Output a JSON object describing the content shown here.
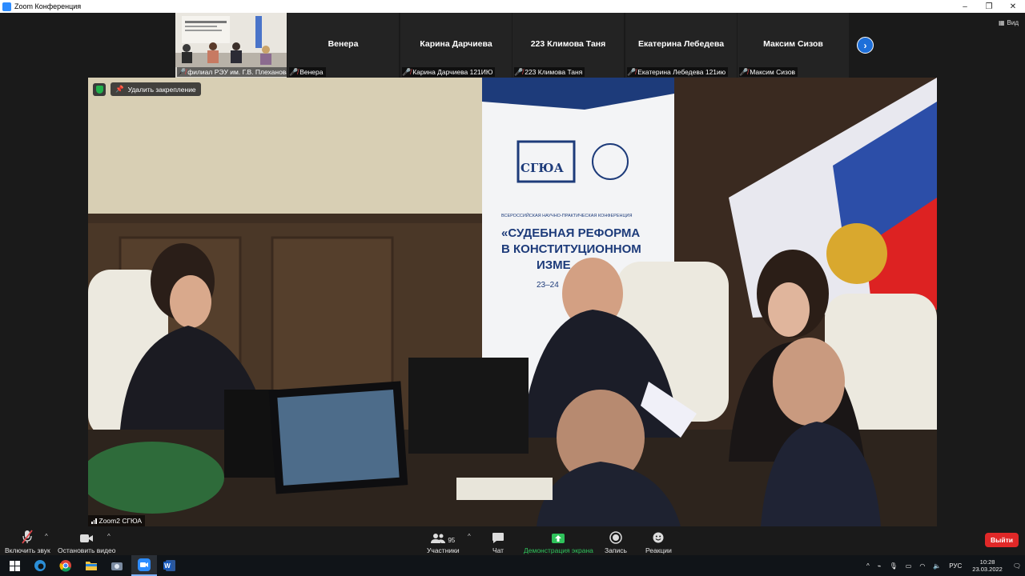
{
  "window": {
    "title": "Zoom Конференция",
    "controls": [
      "–",
      "❐",
      "✕"
    ]
  },
  "gallery": {
    "view_label": "Вид",
    "video_tile": {
      "label": "филиал РЭУ им. Г.В. Плеханова"
    },
    "tiles": [
      {
        "name": "Венера",
        "label": "Венера"
      },
      {
        "name": "Карина  Дарчиева",
        "label": "Карина Дарчиева 121ИЮ"
      },
      {
        "name": "223 Климова Таня",
        "label": "223 Климова Таня"
      },
      {
        "name": "Екатерина  Лебедева",
        "label": "Екатерина Лебедева 121ию"
      },
      {
        "name": "Максим Сизов",
        "label": "Максим Сизов"
      }
    ]
  },
  "main": {
    "unpin_label": "Удалить закрепление",
    "speaker_label": "Zoom2 СГЮА",
    "banner": {
      "org": "СГЮА",
      "subtitle": "ВСЕРОССИЙСКАЯ НАУЧНО-ПРАКТИЧЕСКАЯ КОНФЕРЕНЦИЯ",
      "line1": "«СУДЕБНАЯ РЕФОРМА",
      "line2": "В КОНСТИТУЦИОННОМ",
      "line3": "ИЗМЕ",
      "date": "23–24"
    }
  },
  "toolbar": {
    "audio_label": "Включить звук",
    "video_label": "Остановить видео",
    "participants_label": "Участники",
    "participants_count": "95",
    "chat_label": "Чат",
    "share_label": "Демонстрация экрана",
    "record_label": "Запись",
    "reactions_label": "Реакции",
    "leave_label": "Выйти"
  },
  "taskbar": {
    "lang": "РУС",
    "time": "10:28",
    "date": "23.03.2022"
  },
  "colors": {
    "accent_blue": "#1e6fd9",
    "leave_red": "#e02828",
    "share_green": "#2fc25b",
    "muted_red": "#e0474c"
  }
}
